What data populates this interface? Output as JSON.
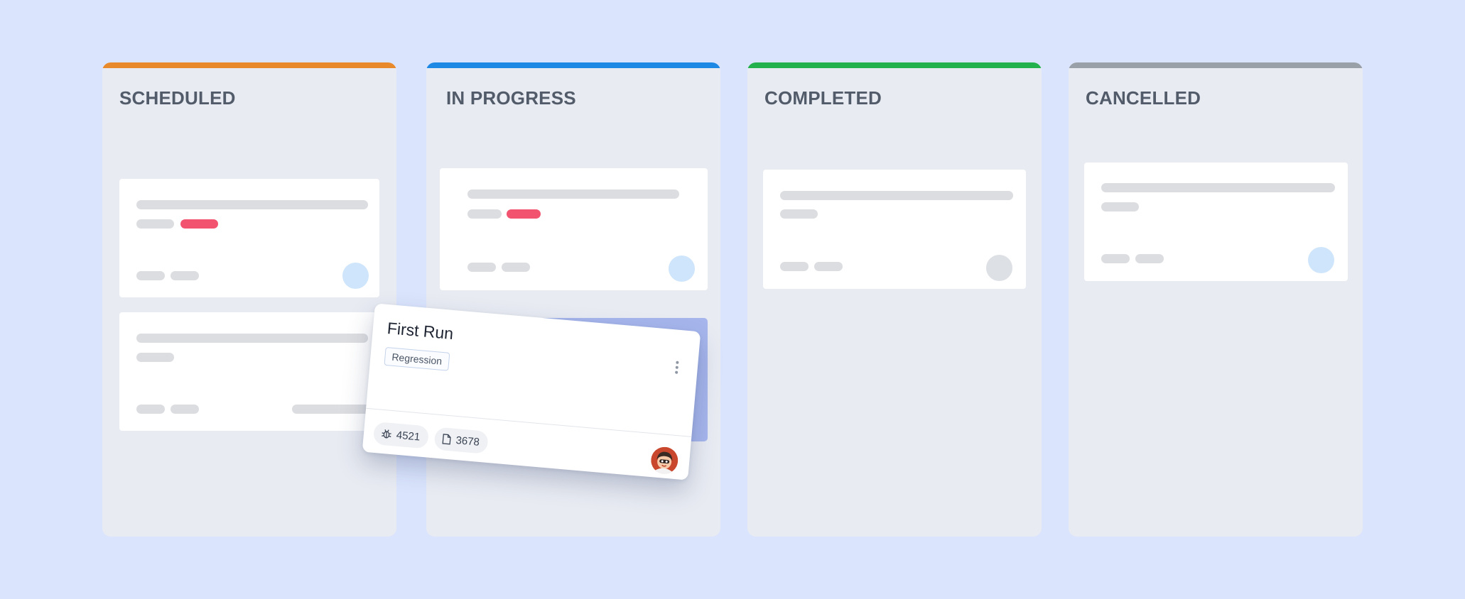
{
  "board": {
    "columns": [
      {
        "title": "SCHEDULED",
        "accent": "#e8892b"
      },
      {
        "title": "IN PROGRESS",
        "accent": "#1e88e5"
      },
      {
        "title": "COMPLETED",
        "accent": "#22b14c"
      },
      {
        "title": "CANCELLED",
        "accent": "#9aa0a8"
      }
    ]
  },
  "drag_card": {
    "title": "First Run",
    "tag": "Regression",
    "bug_count": "4521",
    "doc_count": "3678",
    "bug_icon": "bug-icon",
    "doc_icon": "document-icon"
  },
  "colors": {
    "background": "#dae4fc",
    "column_bg": "#e8ebf2",
    "skeleton": "#dcdde0",
    "priority_red": "#f2546f",
    "avatar_blue": "#cfe5fb",
    "avatar_gray": "#dde0e5",
    "drop_zone": "#a6b6ec"
  }
}
